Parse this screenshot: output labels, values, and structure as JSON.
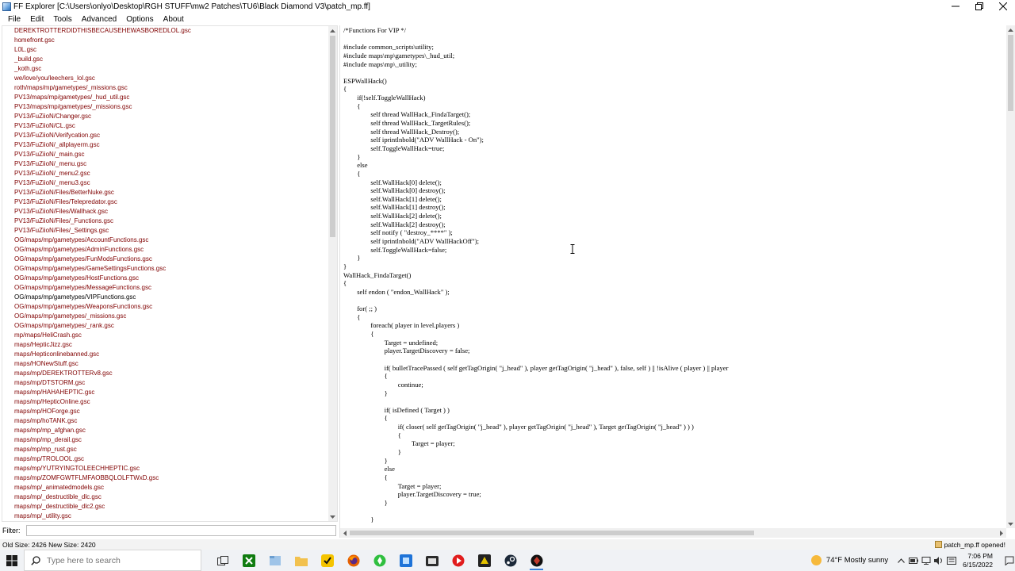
{
  "window": {
    "title": "FF Explorer [C:\\Users\\onlyo\\Desktop\\RGH STUFF\\mw2 Patches\\TU6\\Black Diamond V3\\patch_mp.ff]"
  },
  "menu": [
    "File",
    "Edit",
    "Tools",
    "Advanced",
    "Options",
    "About"
  ],
  "files": [
    "DEREKTROTTERDIDTHISBECAUSEHEWASBOREDLOL.gsc",
    "homefront.gsc",
    "L0L.gsc",
    "_build.gsc",
    "_koth.gsc",
    "we/love/you/leechers_lol.gsc",
    "roth/maps/mp/gametypes/_missions.gsc",
    "PV13/maps/mp/gametypes/_hud_util.gsc",
    "PV13/maps/mp/gametypes/_missions.gsc",
    "PV13/FuZiioN/Changer.gsc",
    "PV13/FuZiioN/CL.gsc",
    "PV13/FuZiioN/Verifycation.gsc",
    "PV13/FuZiioN/_allplayerm.gsc",
    "PV13/FuZiioN/_main.gsc",
    "PV13/FuZiioN/_menu.gsc",
    "PV13/FuZiioN/_menu2.gsc",
    "PV13/FuZiioN/_menu3.gsc",
    "PV13/FuZiioN/Files/BetterNuke.gsc",
    "PV13/FuZiioN/Files/Telepredator.gsc",
    "PV13/FuZiioN/Files/Wallhack.gsc",
    "PV13/FuZiioN/Files/_Functions.gsc",
    "PV13/FuZiioN/Files/_Settings.gsc",
    "OG/maps/mp/gametypes/AccountFunctions.gsc",
    "OG/maps/mp/gametypes/AdminFunctions.gsc",
    "OG/maps/mp/gametypes/FunModsFunctions.gsc",
    "OG/maps/mp/gametypes/GameSettingsFunctions.gsc",
    "OG/maps/mp/gametypes/HostFunctions.gsc",
    "OG/maps/mp/gametypes/MessageFunctions.gsc",
    "OG/maps/mp/gametypes/VIPFunctions.gsc",
    "OG/maps/mp/gametypes/WeaponsFunctions.gsc",
    "OG/maps/mp/gametypes/_missions.gsc",
    "OG/maps/mp/gametypes/_rank.gsc",
    "mp/maps/HeliCrash.gsc",
    "maps/HepticJizz.gsc",
    "maps/Hepticonlinebanned.gsc",
    "maps/HONewStuff.gsc",
    "maps/mp/DEREKTROTTERv8.gsc",
    "maps/mp/DTSTORM.gsc",
    "maps/mp/HAHAHEPTIC.gsc",
    "maps/mp/HepticOnline.gsc",
    "maps/mp/HOForge.gsc",
    "maps/mp/hoTANK.gsc",
    "maps/mp/mp_afghan.gsc",
    "maps/mp/mp_derail.gsc",
    "maps/mp/mp_rust.gsc",
    "maps/mp/TROLOOL.gsc",
    "maps/mp/YUTRYINGTOLEECHHEPTIC.gsc",
    "maps/mp/ZOMFGWTFLMFAOBBQLOLFTWxD.gsc",
    "maps/mp/_animatedmodels.gsc",
    "maps/mp/_destructible_dlc.gsc",
    "maps/mp/_destructible_dlc2.gsc",
    "maps/mp/_utility.gsc"
  ],
  "selected_file": "OG/maps/mp/gametypes/VIPFunctions.gsc",
  "code_lines": [
    "/*Functions For VIP */",
    "",
    "#include common_scripts\\utility;",
    "#include maps\\mp\\gametypes\\_hud_util;",
    "#include maps\\mp\\_utility;",
    "",
    "ESPWallHack()",
    "{",
    "\t\tif(!self.ToggleWallHack)",
    "\t\t{",
    "\t\t\t\tself thread WallHack_FindaTarget();",
    "\t\t\t\tself thread WallHack_TargetRules();",
    "\t\t\t\tself thread WallHack_Destroy();",
    "\t\t\t\tself iprintlnbold(\"ADV WallHack - On\");",
    "\t\t\t\tself.ToggleWallHack=true;",
    "\t\t}",
    "\t\telse",
    "\t\t{",
    "\t\t\t\tself.WallHack[0] delete();",
    "\t\t\t\tself.WallHack[0] destroy();",
    "\t\t\t\tself.WallHack[1] delete();",
    "\t\t\t\tself.WallHack[1] destroy();",
    "\t\t\t\tself.WallHack[2] delete();",
    "\t\t\t\tself.WallHack[2] destroy();",
    "\t\t\t\tself notify ( \"destroy_****\" );",
    "\t\t\t\tself iprintlnbold(\"ADV WallHackOff\");",
    "\t\t\t\tself.ToggleWallHack=false;",
    "\t\t}",
    "}",
    "WallHack_FindaTarget()",
    "{",
    "\t\tself endon ( \"endon_WallHack\" );",
    "",
    "\t\tfor( ;; )",
    "\t\t{",
    "\t\t\t\tforeach( player in level.players )",
    "\t\t\t\t{",
    "\t\t\t\t\t\tTarget = undefined;",
    "\t\t\t\t\t\tplayer.TargetDiscovery = false;",
    "",
    "\t\t\t\t\t\tif( bulletTracePassed ( self getTagOrigin( \"j_head\" ), player getTagOrigin( \"j_head\" ), false, self ) || !isAlive ( player ) || player",
    "\t\t\t\t\t\t{",
    "\t\t\t\t\t\t\t\tcontinue;",
    "\t\t\t\t\t\t}",
    "",
    "\t\t\t\t\t\tif( isDefined ( Target ) )",
    "\t\t\t\t\t\t{",
    "\t\t\t\t\t\t\t\tif( closer( self getTagOrigin( \"j_head\" ), player getTagOrigin( \"j_head\" ), Target getTagOrigin( \"j_head\" ) ) )",
    "\t\t\t\t\t\t\t\t{",
    "\t\t\t\t\t\t\t\t\t\tTarget = player;",
    "\t\t\t\t\t\t\t\t}",
    "\t\t\t\t\t\t}",
    "\t\t\t\t\t\telse",
    "\t\t\t\t\t\t{",
    "\t\t\t\t\t\t\t\tTarget = player;",
    "\t\t\t\t\t\t\t\tplayer.TargetDiscovery = true;",
    "\t\t\t\t\t\t}",
    "",
    "\t\t\t\t}"
  ],
  "filter": {
    "label": "Filter:",
    "value": ""
  },
  "status": {
    "left": "Old Size: 2426  New Size: 2420",
    "right": "patch_mp.ff opened!"
  },
  "taskbar": {
    "search_placeholder": "Type here to search",
    "weather": "74°F  Mostly sunny",
    "time": "7:06 PM",
    "date": "6/15/2022",
    "apps": [
      "task-view",
      "xbox",
      "file-manager",
      "folder",
      "norton",
      "firefox",
      "app-green",
      "app-blue",
      "app-store",
      "app-red",
      "app-yellow",
      "steam",
      "black-diamond"
    ]
  }
}
